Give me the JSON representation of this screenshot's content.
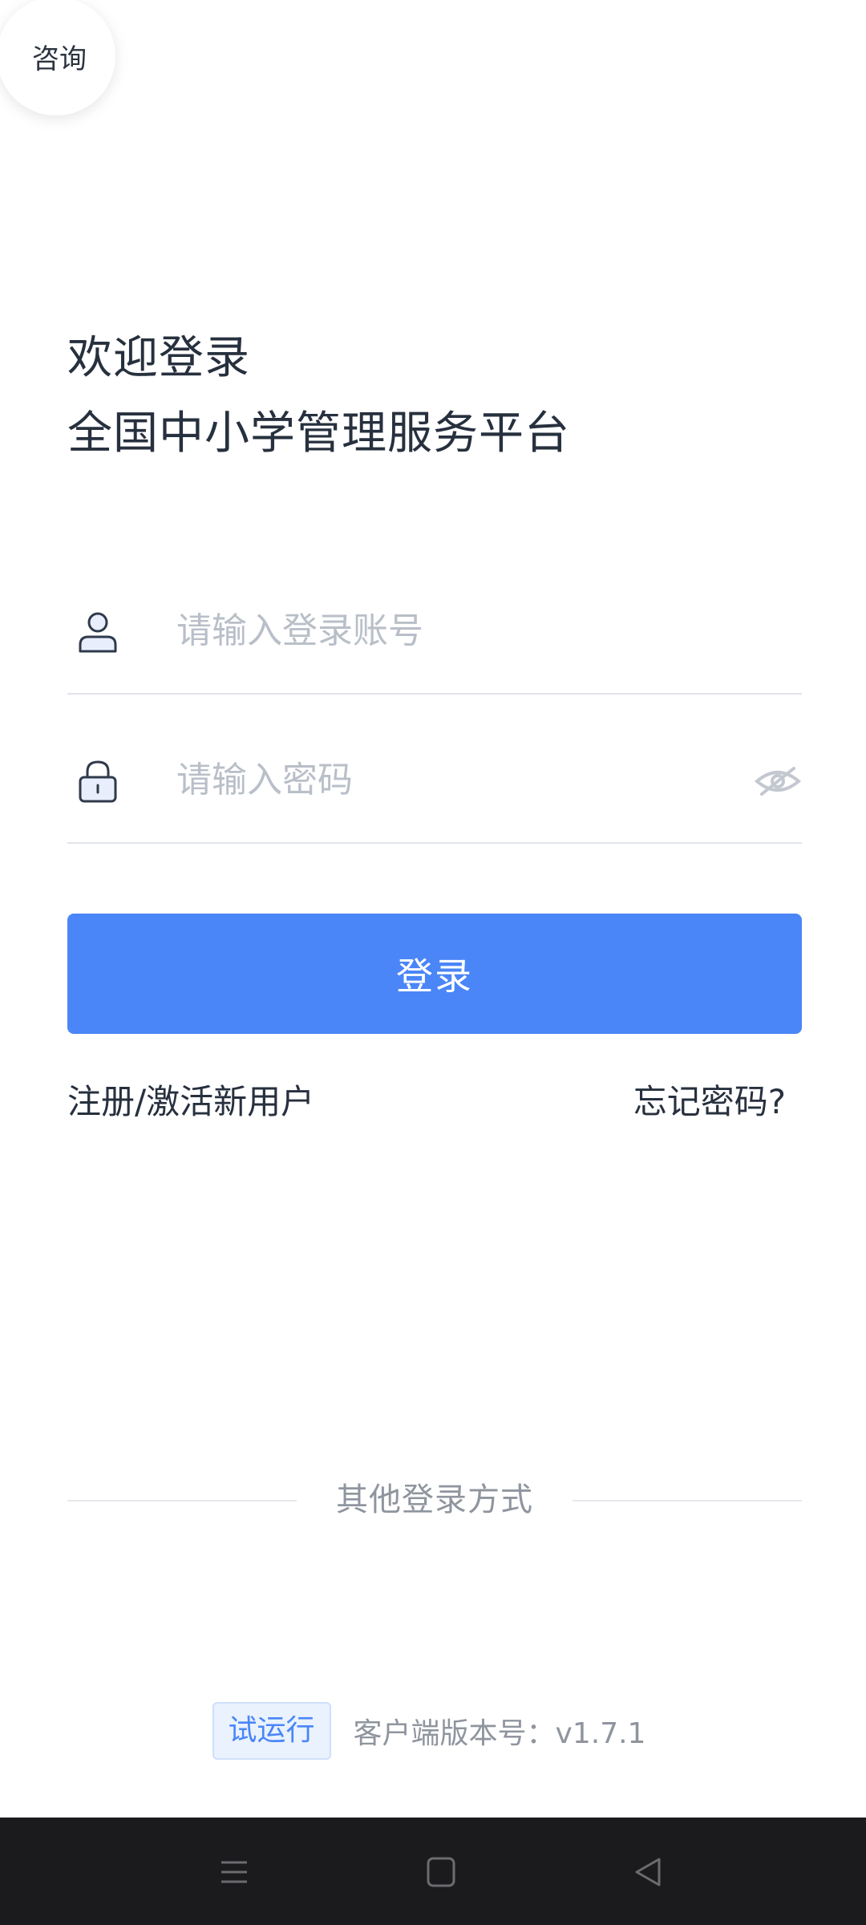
{
  "consult": {
    "label": "咨询"
  },
  "welcome": {
    "line1": "欢迎登录",
    "line2": "全国中小学管理服务平台"
  },
  "account_field": {
    "placeholder": "请输入登录账号",
    "value": ""
  },
  "password_field": {
    "placeholder": "请输入密码",
    "value": ""
  },
  "login_button": {
    "label": "登录"
  },
  "links": {
    "register": "注册/激活新用户",
    "forgot": "忘记密码?"
  },
  "other_login": {
    "label": "其他登录方式"
  },
  "footer": {
    "badge": "试运行",
    "version": "客户端版本号：v1.7.1"
  },
  "icons": {
    "account": "user-icon",
    "password": "lock-icon",
    "eye": "eye-hidden-icon",
    "nav_menu": "menu-icon",
    "nav_home": "home-square-icon",
    "nav_back": "back-triangle-icon"
  },
  "colors": {
    "primary": "#4a86f7",
    "text": "#27303e",
    "placeholder": "#b9bfc8",
    "muted": "#8f959e",
    "badge_bg": "#eaf2fe",
    "navbar": "#1b1b1d"
  }
}
